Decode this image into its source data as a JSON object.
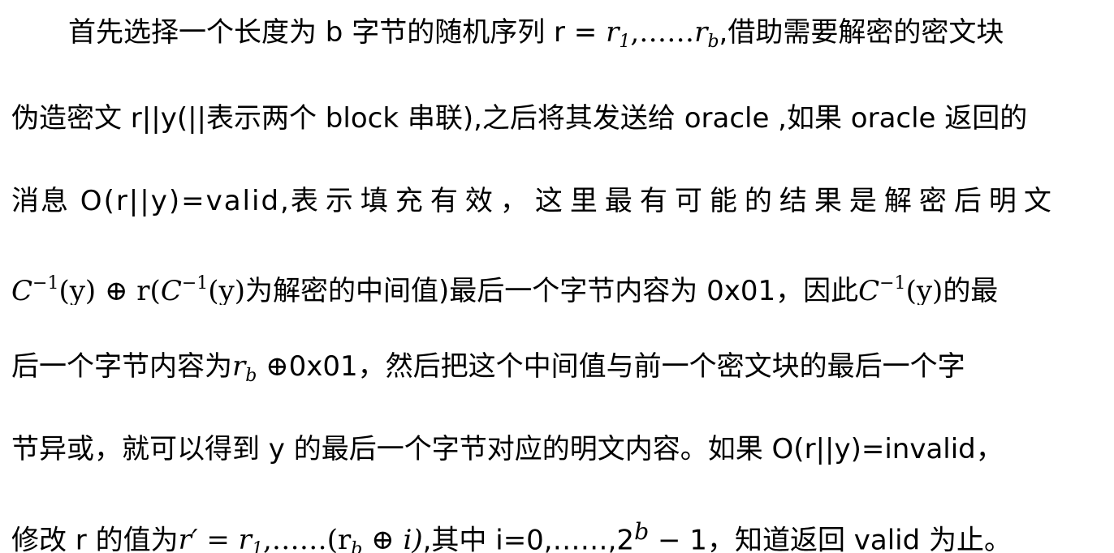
{
  "paragraph": {
    "l1": {
      "a": "首先选择一个长度为 b 字节的随机序列 r = ",
      "m_r": "r",
      "m_sub1": "1",
      "m_dots": ",……",
      "m_rb": "r",
      "m_subb": "b",
      "b": ",借助需要解密的密文块"
    },
    "l2": {
      "a": "伪造密文 r||y(||表示两个 block 串联),之后将其发送给 oracle ,如果 oracle 返回的"
    },
    "l3": {
      "a": "消息  O(r||y)=valid,",
      "b": "表示填充有效，这里最有可能的结果是解密后明文"
    },
    "l4": {
      "m_c": "C",
      "m_sup": "−1",
      "m_y": "(y) ⊕ r(",
      "m_c2": "C",
      "m_sup2": "−1",
      "m_y2": "(y)",
      "a": "为解密的中间值)最后一个字节内容为 0x01，因此",
      "m_c3": "C",
      "m_sup3": "−1",
      "m_y3": "(y)",
      "b": "的最"
    },
    "l5": {
      "a": "后一个字节内容为",
      "m_r": "r",
      "m_sub": "b",
      "m_op": " ⊕",
      "b": "0x01，然后把这个中间值与前一个密文块的最后一个字"
    },
    "l6": {
      "a": "节异或，就可以得到 y 的最后一个字节对应的明文内容。如果 O(r||y)=invalid，"
    },
    "l7": {
      "a": "修改 r 的值为",
      "m_rp": "r′ = r",
      "m_sub1": "1",
      "m_mid": ",……(r",
      "m_subb": "b",
      "m_end": " ⊕ i)",
      "b": ",其中 ",
      "i": "i",
      "c": "=0,……,2",
      "sup": "b",
      "d": " − 1，知道返回 valid 为止。"
    }
  }
}
